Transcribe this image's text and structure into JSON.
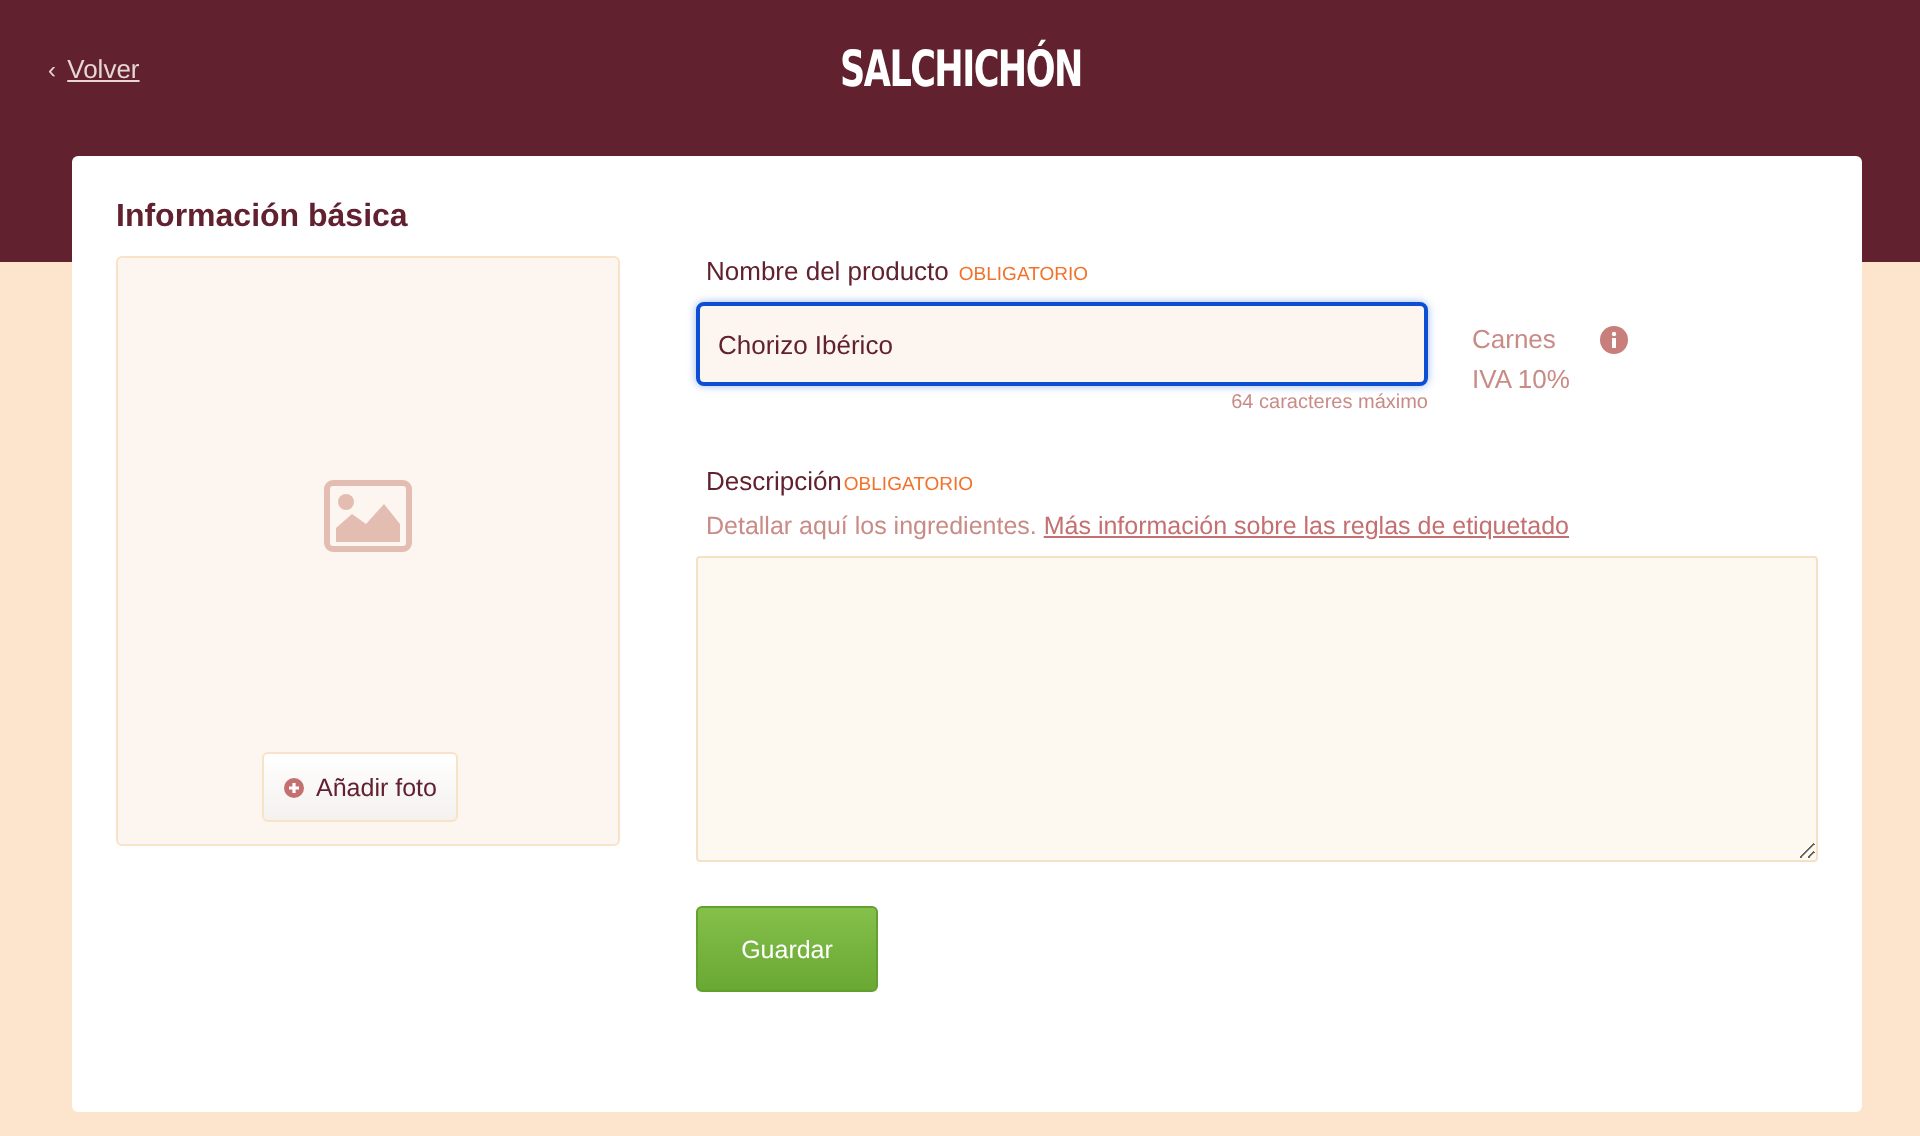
{
  "header": {
    "back_link": "Volver",
    "back_icon": "‹",
    "title": "SALCHICHÓN"
  },
  "section": {
    "title": "Información básica"
  },
  "photo": {
    "add_button": "Añadir foto"
  },
  "name_field": {
    "label": "Nombre del producto",
    "required": "OBLIGATORIO",
    "value": "Chorizo Ibérico",
    "focused": true,
    "hint": "64 caracteres máximo"
  },
  "category": {
    "name": "Carnes",
    "tax": "IVA 10%"
  },
  "description_field": {
    "label": "Descripción",
    "required": "OBLIGATORIO",
    "help": "Detallar aquí los ingredientes.",
    "help_link": "Más información sobre las reglas de etiquetado"
  },
  "save_button": "Guardar"
}
